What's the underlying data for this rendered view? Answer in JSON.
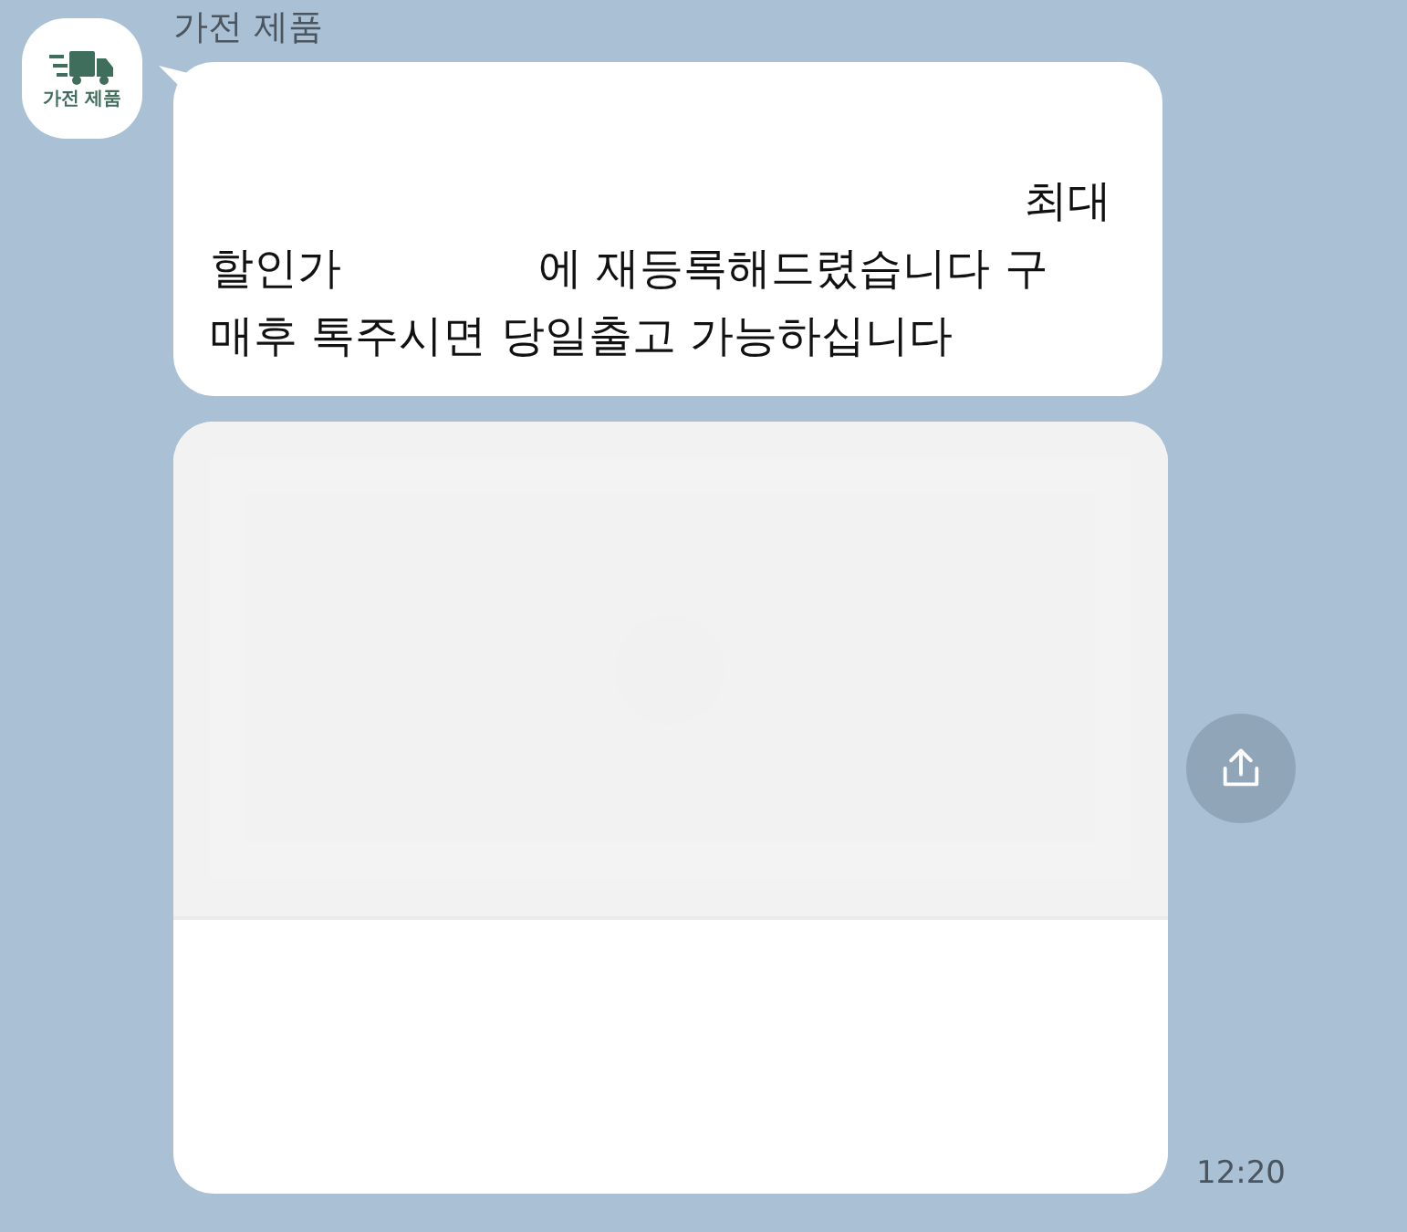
{
  "sender": {
    "name": "가전 제품",
    "avatar_label": "가전 제품"
  },
  "message": {
    "lines": [
      {
        "right": "최대"
      },
      {
        "left": "할인가",
        "right": "에 재등록해드렸습니다 구"
      },
      {
        "left": "매후 톡주시면 당일출고 가능하십니다"
      }
    ]
  },
  "time": "12:20"
}
